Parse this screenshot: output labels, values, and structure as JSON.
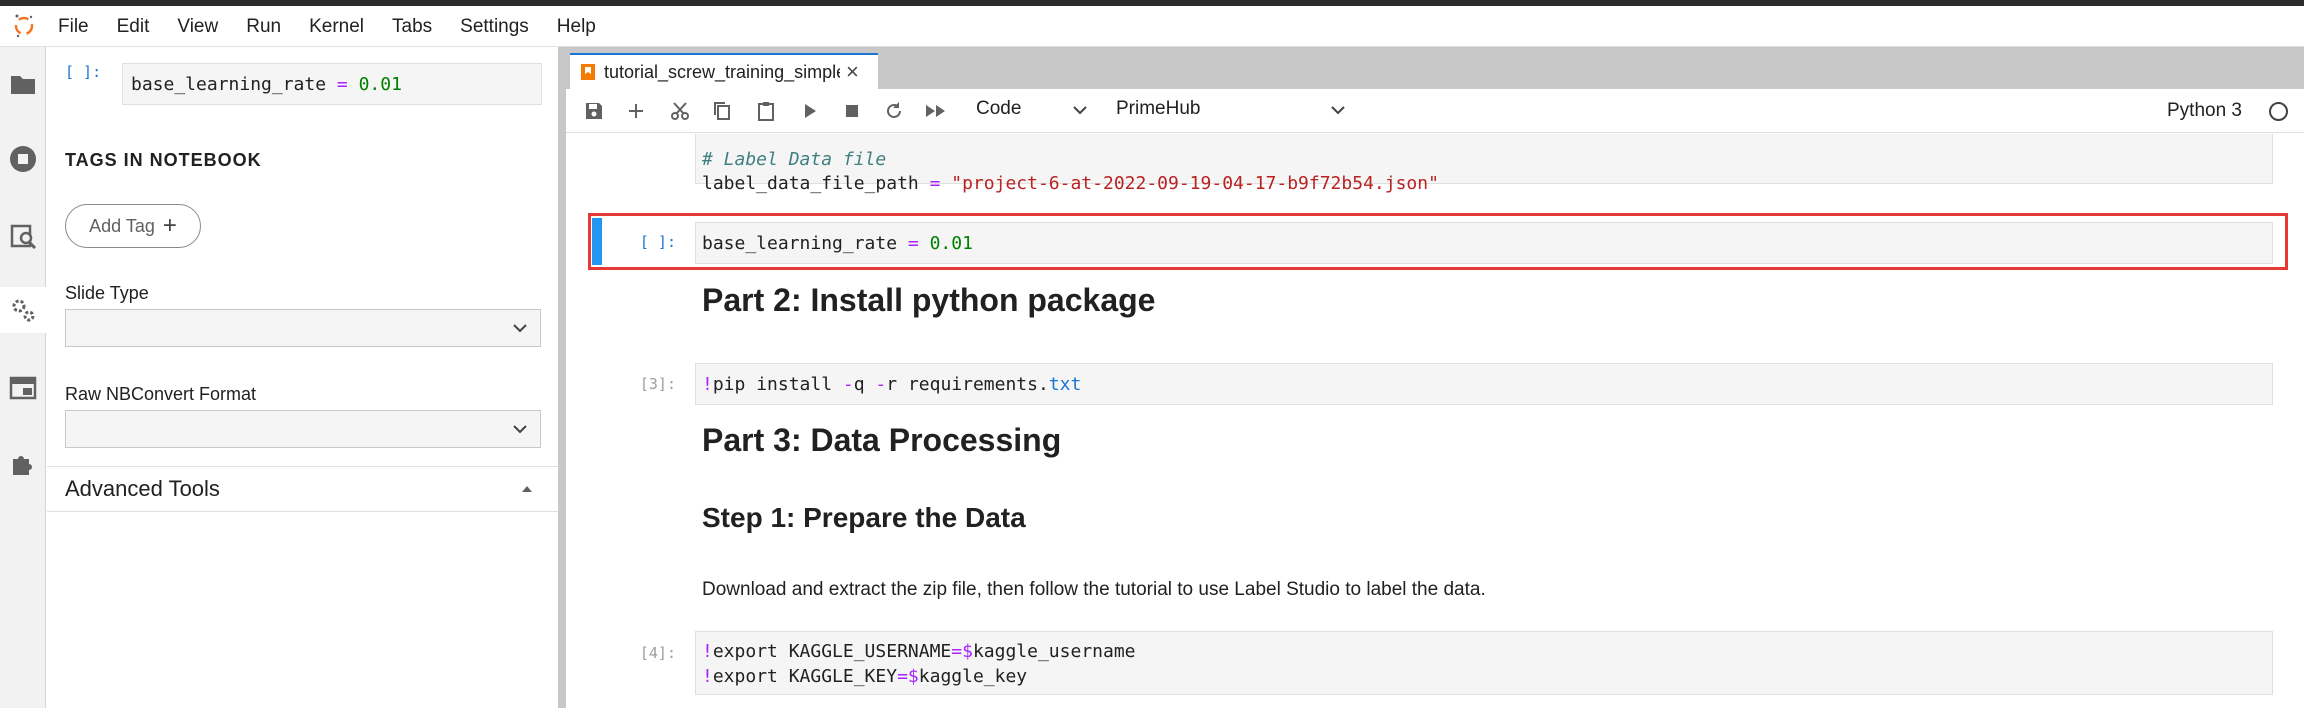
{
  "menu": [
    "File",
    "Edit",
    "View",
    "Run",
    "Kernel",
    "Tabs",
    "Settings",
    "Help"
  ],
  "activity_icons": [
    "folder-icon",
    "running-icon",
    "commands-icon",
    "property-inspector-icon",
    "tabs-icon",
    "extension-icon"
  ],
  "sidebar": {
    "prev_cell_prompt": "[ ]:",
    "prev_cell_code": {
      "name": "base_learning_rate",
      "op": " = ",
      "value": "0.01"
    },
    "tags_title": "TAGS IN NOTEBOOK",
    "add_tag_label": "Add Tag",
    "add_tag_icon": "+",
    "slide_type_label": "Slide Type",
    "slide_type_value": "",
    "raw_format_label": "Raw NBConvert Format",
    "raw_format_value": "",
    "advanced_tools_label": "Advanced Tools"
  },
  "tab": {
    "label": "tutorial_screw_training_simple.ipynb",
    "close": "×"
  },
  "toolbar": {
    "cell_type": "Code",
    "image": "PrimeHub",
    "kernel": "Python 3"
  },
  "cells": {
    "c0_comment": "# Label Data file",
    "c0_line2_name": "label_data_file_path",
    "c0_line2_op": " = ",
    "c0_line2_value": "\"project-6-at-2022-09-19-04-17-b9f72b54.json\"",
    "c1_prompt": "[ ]:",
    "c1_name": "base_learning_rate",
    "c1_op": " = ",
    "c1_value": "0.01",
    "md1": "Part 2: Install python package",
    "c2_prompt": "[3]:",
    "c2_bang": "!",
    "c2_part1": "pip install ",
    "c2_flag1": "-",
    "c2_part2": "q ",
    "c2_flag2": "-",
    "c2_part3": "r requirements.",
    "c2_part4": "txt",
    "md2": "Part 3: Data Processing",
    "md3": "Step 1: Prepare the Data",
    "md4": "Download and extract the zip file, then follow the tutorial to use Label Studio to label the data.",
    "c3_prompt": "[4]:",
    "c3_l1_bang": "!",
    "c3_l1_text": "export KAGGLE_USERNAME",
    "c3_l1_eq": "=",
    "c3_l1_dollar": "$",
    "c3_l1_var": "kaggle_username",
    "c3_l2_bang": "!",
    "c3_l2_text": "export KAGGLE_KEY",
    "c3_l2_eq": "=",
    "c3_l2_dollar": "$",
    "c3_l2_var": "kaggle_key"
  },
  "colors": {
    "accent": "#1976d2",
    "active_cell_bar": "#2196f3",
    "highlight_border": "#e53935",
    "code_number": "#008000",
    "code_string": "#ba2121",
    "code_operator": "#aa22ff",
    "code_comment": "#408080"
  }
}
